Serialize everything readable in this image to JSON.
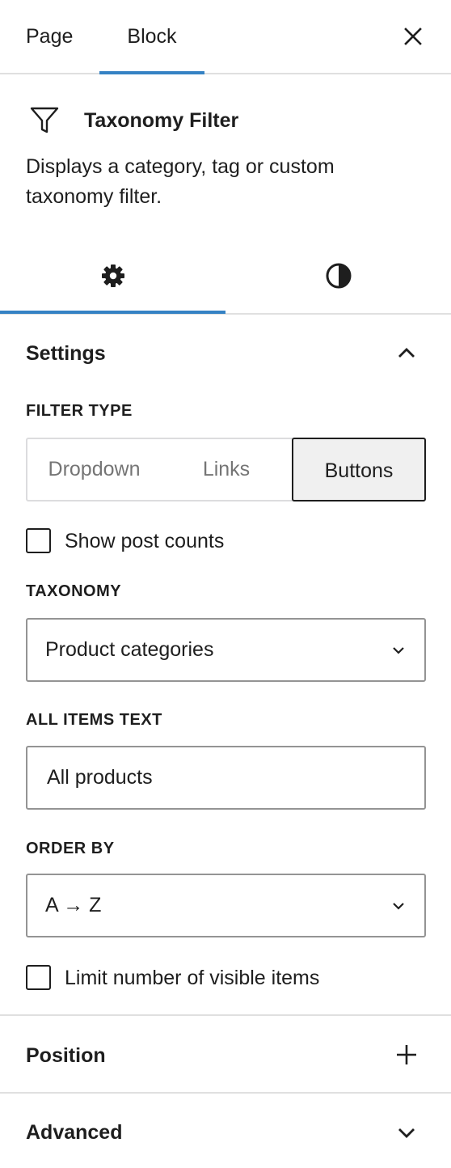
{
  "tabs": {
    "page": "Page",
    "block": "Block"
  },
  "block": {
    "title": "Taxonomy Filter",
    "description": "Displays a category, tag or custom taxonomy filter."
  },
  "sub_tabs": {
    "active": "settings",
    "icons": [
      "gear-icon",
      "contrast-icon"
    ]
  },
  "settings": {
    "title": "Settings",
    "filter_type": {
      "label": "FILTER TYPE",
      "options": [
        "Dropdown",
        "Links",
        "Buttons"
      ],
      "selected": "Buttons"
    },
    "show_post_counts": {
      "label": "Show post counts",
      "checked": false
    },
    "taxonomy": {
      "label": "TAXONOMY",
      "value": "Product categories"
    },
    "all_items_text": {
      "label": "ALL ITEMS TEXT",
      "value": "All products"
    },
    "order_by": {
      "label": "ORDER BY",
      "value": "A → Z"
    },
    "limit_visible": {
      "label": "Limit number of visible items",
      "checked": false
    }
  },
  "panels": {
    "position": {
      "title": "Position",
      "icon": "plus-icon"
    },
    "advanced": {
      "title": "Advanced",
      "icon": "chevron-down-icon"
    }
  },
  "colors": {
    "accent": "#3582c4",
    "text": "#1e1e1e",
    "border": "#949494",
    "muted": "#757575"
  }
}
